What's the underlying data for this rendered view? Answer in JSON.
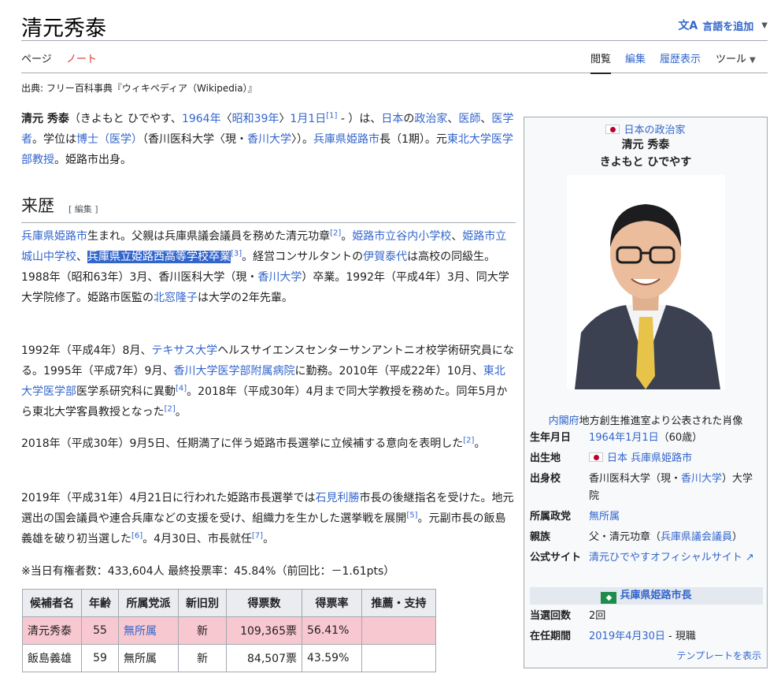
{
  "page": {
    "title": "清元秀泰",
    "add_languages": "言語を追加",
    "tabs_left": [
      "ページ",
      "ノート"
    ],
    "tabs_right": [
      "閲覧",
      "編集",
      "履歴表示",
      "ツール"
    ],
    "from_line": "出典: フリー百科事典『ウィキペディア（Wikipedia）』"
  },
  "section": {
    "heading": "来歴",
    "edit_label": "[ 編集 ]"
  },
  "election": {
    "votes_line": "※当日有権者数：433,604人 最終投票率：45.84%（前回比：－1.61pts）",
    "headers": [
      "候補者名",
      "年齢",
      "所属党派",
      "新旧別",
      "得票数",
      "得票率",
      "推薦・支持"
    ],
    "rows": [
      [
        "清元秀泰",
        "55",
        "無所属",
        "新",
        "109,365票",
        "56.41%",
        ""
      ],
      [
        "飯島義雄",
        "59",
        "無所属",
        "新",
        "84,507票",
        "43.59%",
        ""
      ]
    ]
  },
  "infobox": {
    "top_label": "日本の政治家",
    "name": "清元 秀泰",
    "reading": "きよもと ひでやす",
    "caption_link": "内閣府",
    "caption_rest": "地方創生推進室より公表された肖像",
    "rows": [
      {
        "key": "生年月日",
        "value_link": "1964年1月1日",
        "value_rest": "（60歳）"
      },
      {
        "key": "出生地",
        "value_link": "日本 兵庫県姫路市",
        "value_rest": ""
      },
      {
        "key": "出身校",
        "value_pre": "香川医科大学（現・",
        "value_link": "香川大学",
        "value_rest": "）大学院"
      },
      {
        "key": "所属政党",
        "value_link": "無所属",
        "value_rest": ""
      },
      {
        "key": "親族",
        "value_pre": "父・清元功章（",
        "value_link": "兵庫県議会議員",
        "value_rest": "）"
      },
      {
        "key": "公式サイト",
        "value_link": "清元ひでやすオフィシャルサイト",
        "value_rest": ""
      }
    ],
    "office": "兵庫県姫路市長",
    "rows2": [
      {
        "key": "当選回数",
        "value": "2回"
      },
      {
        "key": "在任期間",
        "value_link": "2019年4月30日",
        "value_rest": " - 現職"
      }
    ],
    "template_link": "テンプレートを表示"
  }
}
